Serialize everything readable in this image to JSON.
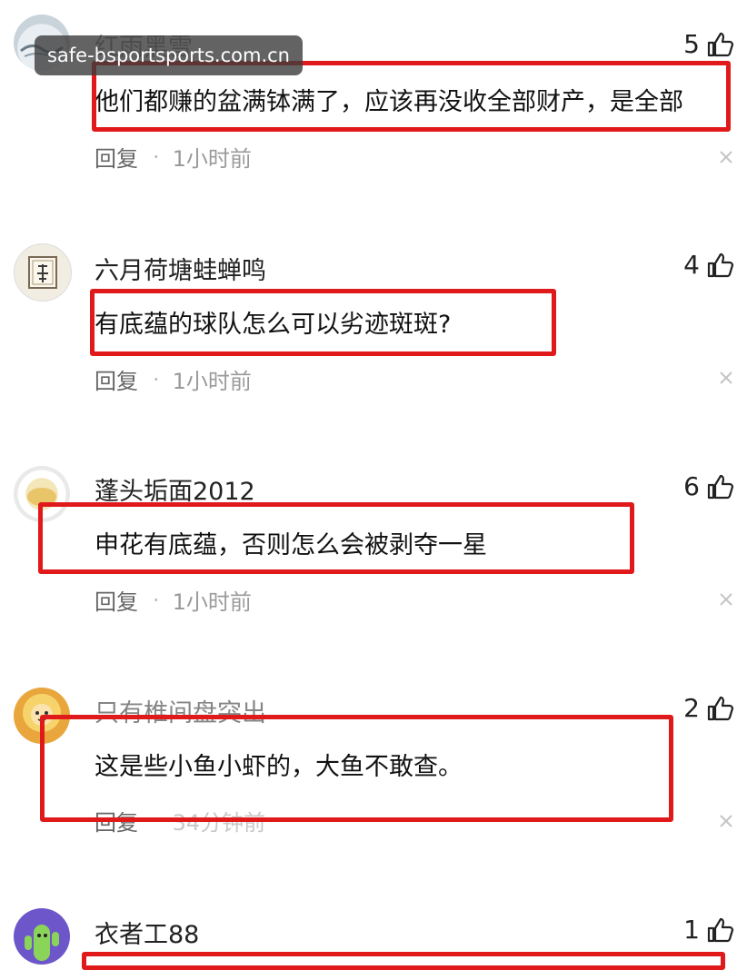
{
  "watermark": "safe-bsportsports.com.cn",
  "comments": [
    {
      "user": "红雨黑雪",
      "likes": "5",
      "text": "他们都赚的盆满钵满了，应该再没收全部财产，是全部",
      "reply": "回复",
      "dot": "·",
      "time": "1小时前"
    },
    {
      "user": "六月荷塘蛙蝉鸣",
      "likes": "4",
      "text": "有底蕴的球队怎么可以劣迹斑斑?",
      "reply": "回复",
      "dot": "·",
      "time": "1小时前"
    },
    {
      "user": "蓬头垢面2012",
      "likes": "6",
      "text": "申花有底蕴，否则怎么会被剥夺一星",
      "reply": "回复",
      "dot": "·",
      "time": "1小时前"
    },
    {
      "user": "只有椎间盘突出",
      "likes": "2",
      "text": "这是些小鱼小虾的，大鱼不敢查。",
      "reply": "回复",
      "dot": "·",
      "time": "34分钟前"
    },
    {
      "user": "衣者工88",
      "likes": "1"
    }
  ],
  "colors": {
    "highlight": "#e0191b",
    "meta": "#9a9a9a"
  },
  "icons": {
    "like": "thumbs-up-icon",
    "close": "close-icon"
  }
}
